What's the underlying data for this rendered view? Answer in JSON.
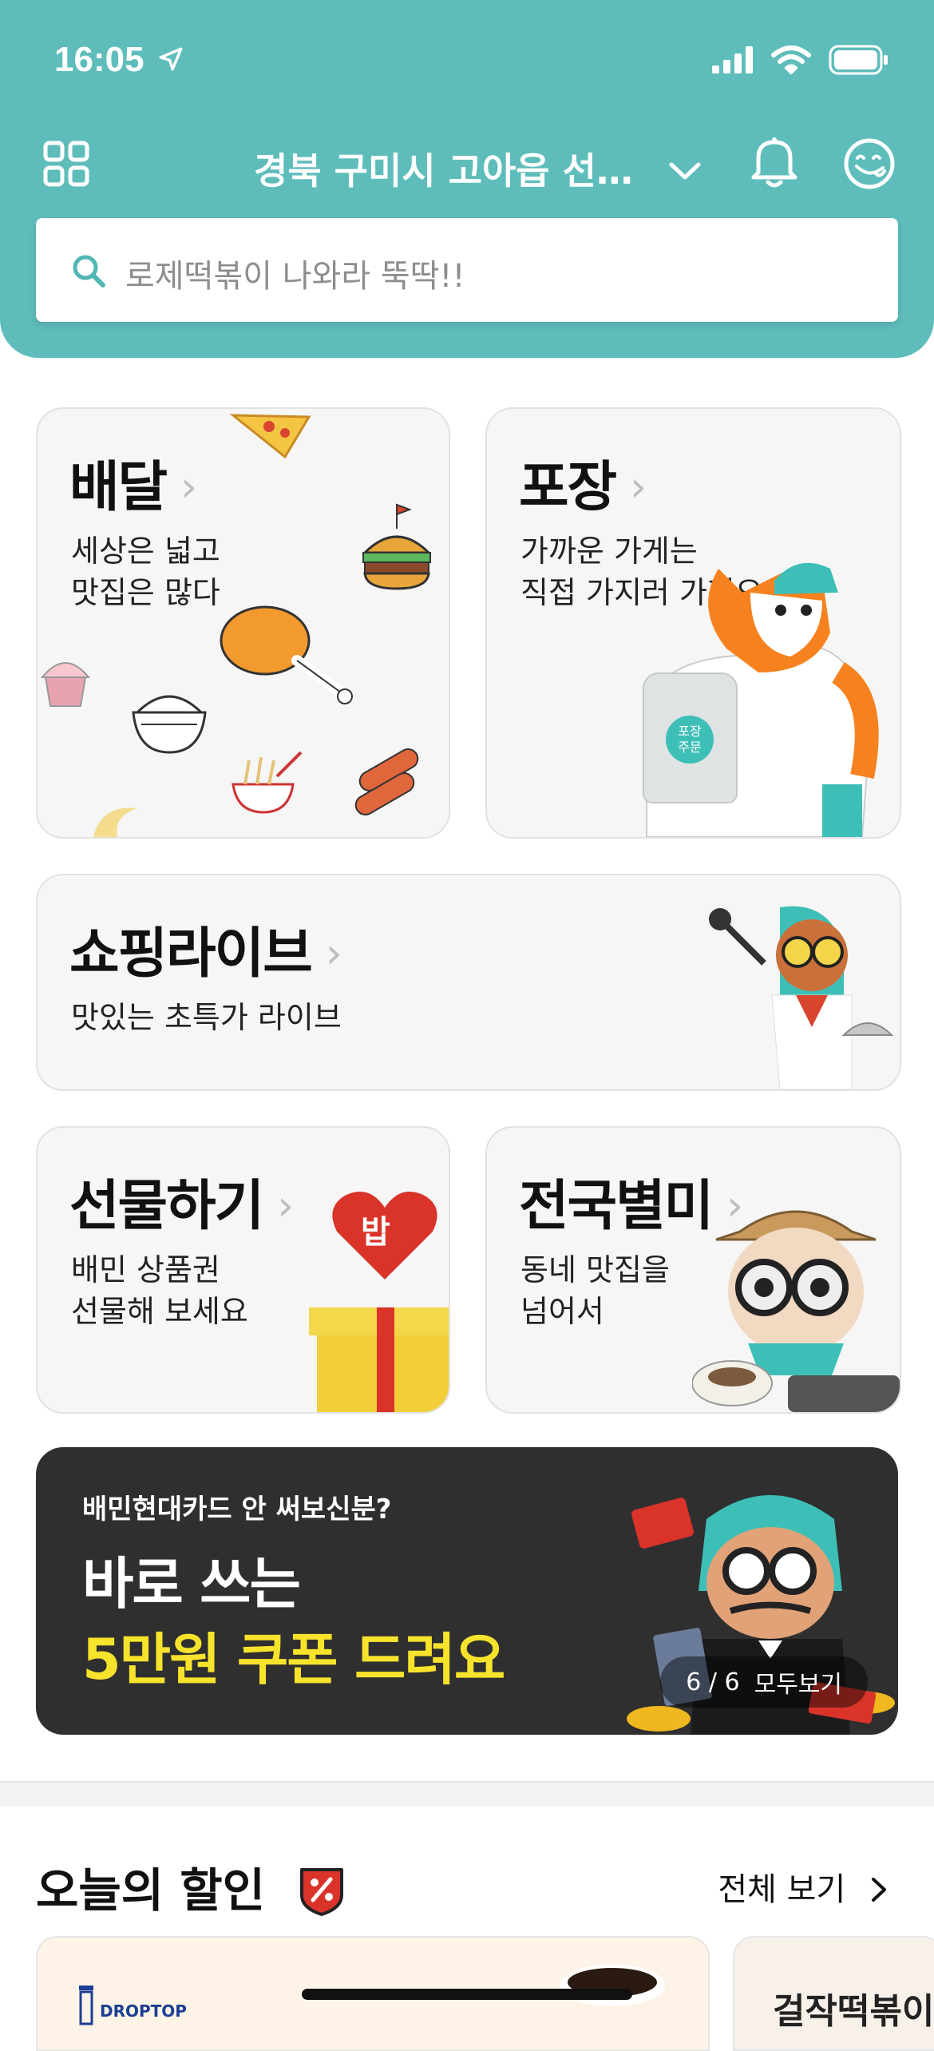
{
  "status": {
    "time": "16:05"
  },
  "header": {
    "location": "경북 구미시 고아읍 선…",
    "search_placeholder": "로제떡볶이 나와라 뚝딱!!"
  },
  "cards": {
    "delivery": {
      "title": "배달",
      "subtitle": "세상은 넓고\n맛집은 많다"
    },
    "takeout": {
      "title": "포장",
      "subtitle": "가까운 가게는\n직접 가지러 가지요",
      "bag_label": "포장\n주문"
    },
    "shopping_live": {
      "title": "쇼핑라이브",
      "subtitle": "맛있는 초특가 라이브"
    },
    "gift": {
      "title": "선물하기",
      "subtitle": "배민 상품권\n선물해 보세요",
      "heart_label": "밥"
    },
    "national": {
      "title": "전국별미",
      "subtitle": "동네 맛집을\n넘어서"
    }
  },
  "promo": {
    "small": "배민현대카드 안 써보신분?",
    "line1": "바로 쓰는",
    "line2": "5만원 쿠폰 드려요",
    "pager": "6 / 6",
    "view_all": "모두보기",
    "accent": "#f8e32c"
  },
  "section": {
    "title": "오늘의 할인",
    "link": "전체 보기"
  },
  "bottom_cards": {
    "left_logo": "DROPTOP",
    "right_logo": "걸작떡볶이"
  },
  "colors": {
    "brand": "#5ebdbb",
    "card_bg": "#f6f6f6",
    "promo_bg": "#2f2f2f"
  }
}
